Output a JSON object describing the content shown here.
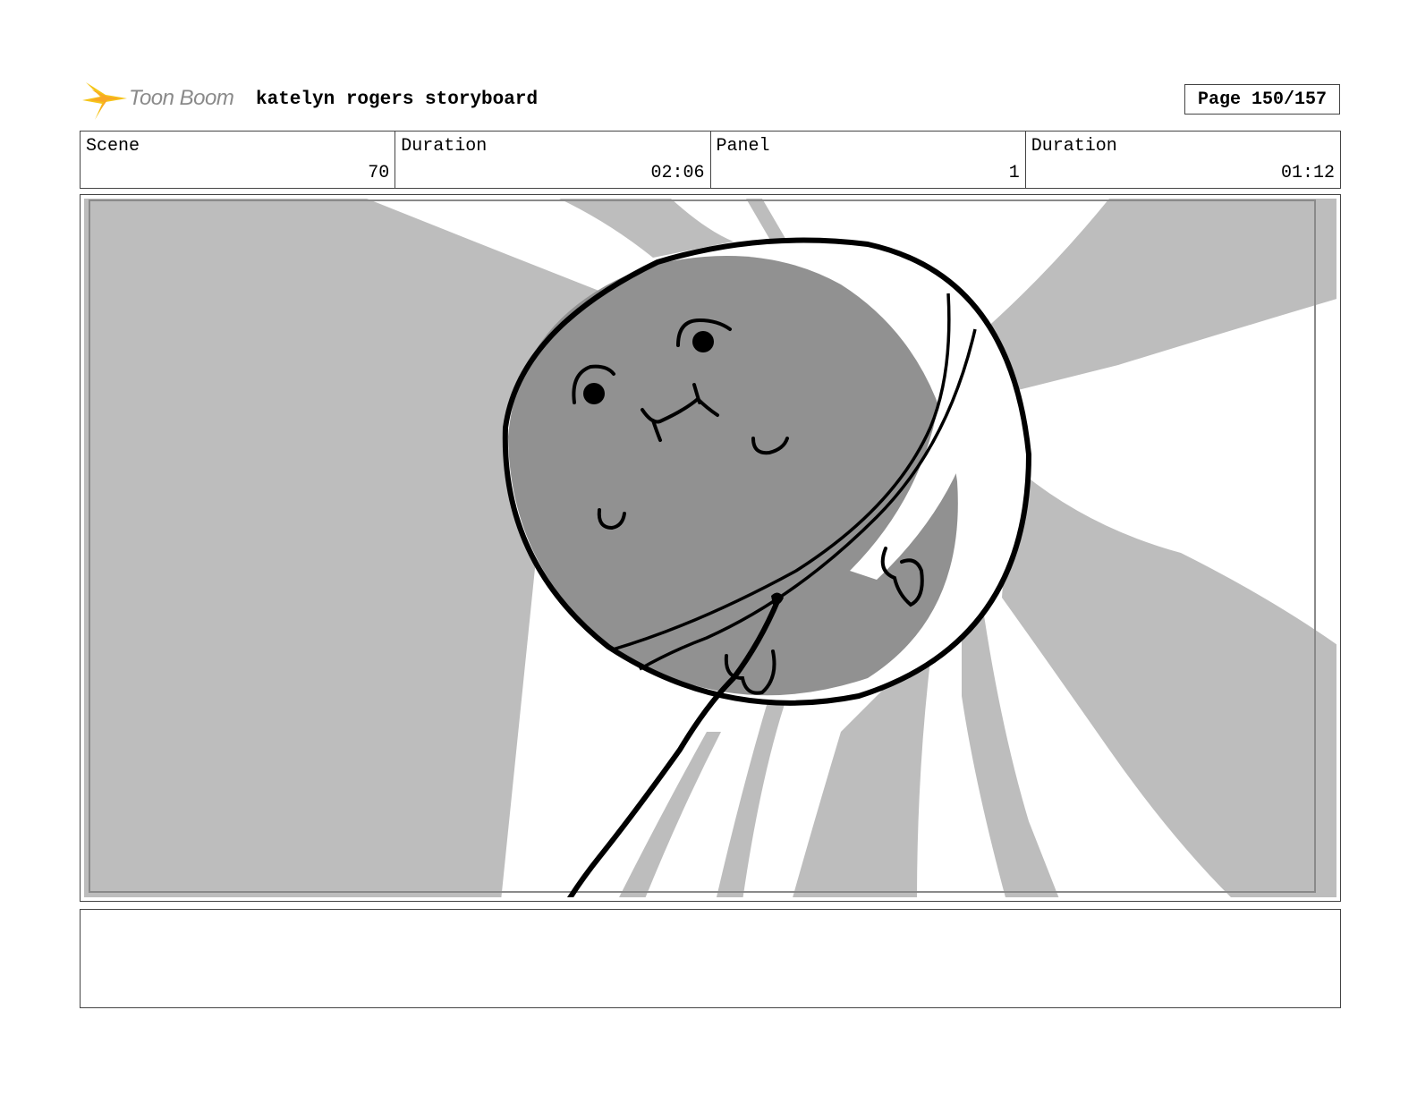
{
  "header": {
    "logo_text": "Toon Boom",
    "title": "katelyn rogers storyboard",
    "page": "Page 150/157"
  },
  "info": [
    {
      "label": "Scene",
      "value": "70"
    },
    {
      "label": "Duration",
      "value": "02:06"
    },
    {
      "label": "Panel",
      "value": "1"
    },
    {
      "label": "Duration",
      "value": "01:12"
    }
  ],
  "notes": "",
  "colors": {
    "light_gray": "#bdbdbd",
    "dark_gray": "#919191",
    "logo_yellow": "#f5c518",
    "logo_text": "#8a8a8a"
  },
  "icons": {
    "logo": "toon-boom-star-icon"
  }
}
